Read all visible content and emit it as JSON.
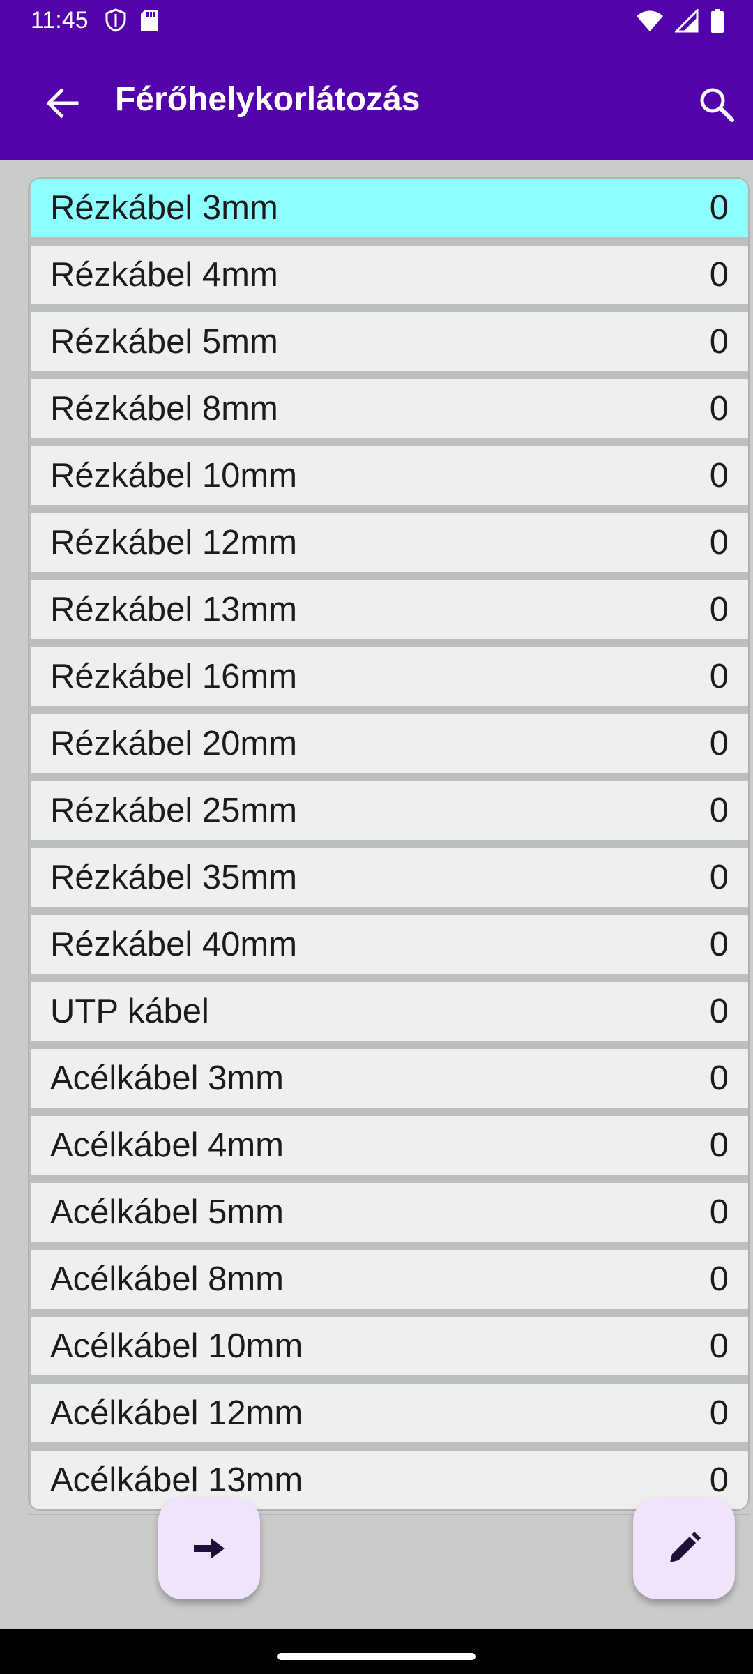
{
  "status_bar": {
    "time": "11:45"
  },
  "app_bar": {
    "title": "Férőhelykorlátozás"
  },
  "list": {
    "items": [
      {
        "label": "Rézkábel 3mm",
        "value": "0",
        "selected": true
      },
      {
        "label": "Rézkábel 4mm",
        "value": "0"
      },
      {
        "label": "Rézkábel 5mm",
        "value": "0"
      },
      {
        "label": "Rézkábel 8mm",
        "value": "0"
      },
      {
        "label": "Rézkábel 10mm",
        "value": "0"
      },
      {
        "label": "Rézkábel 12mm",
        "value": "0"
      },
      {
        "label": "Rézkábel 13mm",
        "value": "0"
      },
      {
        "label": "Rézkábel 16mm",
        "value": "0"
      },
      {
        "label": "Rézkábel 20mm",
        "value": "0"
      },
      {
        "label": "Rézkábel 25mm",
        "value": "0"
      },
      {
        "label": "Rézkábel 35mm",
        "value": "0"
      },
      {
        "label": "Rézkábel 40mm",
        "value": "0"
      },
      {
        "label": "UTP kábel",
        "value": "0"
      },
      {
        "label": "Acélkábel 3mm",
        "value": "0"
      },
      {
        "label": "Acélkábel 4mm",
        "value": "0"
      },
      {
        "label": "Acélkábel 5mm",
        "value": "0"
      },
      {
        "label": "Acélkábel 8mm",
        "value": "0"
      },
      {
        "label": "Acélkábel 10mm",
        "value": "0"
      },
      {
        "label": "Acélkábel 12mm",
        "value": "0"
      },
      {
        "label": "Acélkábel 13mm",
        "value": "0"
      }
    ]
  },
  "icons": {
    "back": "arrow-left-icon",
    "search": "search-icon",
    "next": "arrow-right-icon",
    "edit": "pencil-icon"
  },
  "colors": {
    "primary": "#5303aa",
    "selected_row": "#8effff",
    "row": "#efefef",
    "fab": "#efe4fb"
  }
}
